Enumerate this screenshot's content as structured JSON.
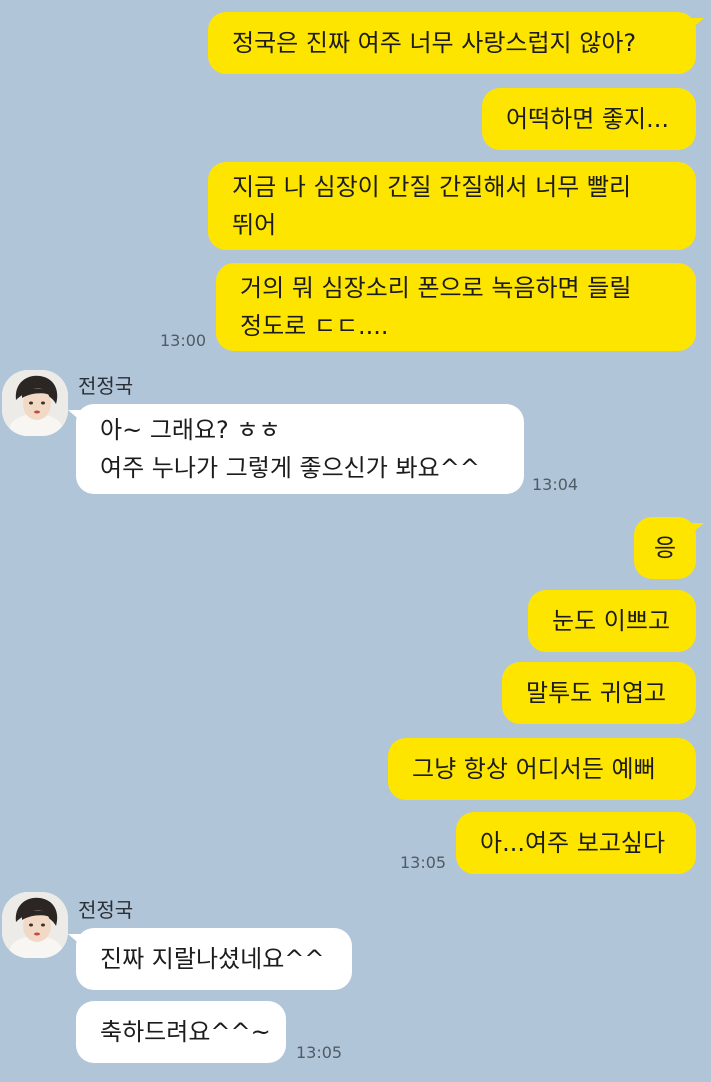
{
  "messages": {
    "m1": "정국은 진짜 여주 너무 사랑스럽지 않아?",
    "m2": "어떡하면 좋지...",
    "m3_line1": "지금 나 심장이 간질 간질해서 너무 빨리",
    "m3_line2": "뛰어",
    "m4_line1": "거의 뭐 심장소리 폰으로 녹음하면 들릴",
    "m4_line2": "정도로 ㄷㄷ....",
    "t1": "13:00",
    "sender1": "전정국",
    "r1_line1": "아~ 그래요? ㅎㅎ",
    "r1_line2": "여주 누나가 그렇게 좋으신가 봐요^^",
    "t2": "13:04",
    "m5": "응",
    "m6": "눈도 이쁘고",
    "m7": "말투도 귀엽고",
    "m8": "그냥 항상 어디서든 예뻐",
    "m9": "아...여주 보고싶다",
    "t3": "13:05",
    "sender2": "전정국",
    "r2": "진짜 지랄나셨네요^^",
    "r3": "축하드려요^^~",
    "t4": "13:05"
  },
  "colors": {
    "background": "#b1c5d8",
    "outgoing_bubble": "#fee500",
    "incoming_bubble": "#ffffff"
  }
}
